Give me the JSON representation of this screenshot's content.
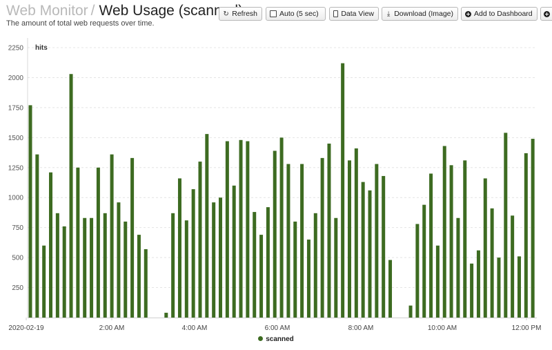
{
  "header": {
    "breadcrumb_parent": "Web Monitor",
    "separator": "/",
    "title": "Web Usage (scanned)",
    "subtitle": "The amount of total web requests over time."
  },
  "toolbar": {
    "refresh_label": "Refresh",
    "auto_label": "Auto (5 sec)",
    "data_view_label": "Data View",
    "download_label": "Download (Image)",
    "dashboard_label": "Add to Dashboard",
    "refresh_icon": "refresh-icon",
    "download_icon": "download-icon",
    "dashboard_icon": "plus-circle-icon"
  },
  "chart_data": {
    "type": "bar",
    "ylabel": "hits",
    "ylim": [
      0,
      2250
    ],
    "yticks": [
      250,
      500,
      750,
      1000,
      1250,
      1500,
      1750,
      2000,
      2250
    ],
    "grid": true,
    "legend_position": "bottom-center",
    "bar_color": "#3d6b21",
    "xtick_labels": [
      "2020-02-19",
      "2:00 AM",
      "4:00 AM",
      "6:00 AM",
      "8:00 AM",
      "10:00 AM",
      "12:00 PM"
    ],
    "series": [
      {
        "name": "scanned",
        "values": [
          1770,
          1360,
          600,
          1210,
          870,
          760,
          2030,
          1250,
          830,
          830,
          1250,
          870,
          1360,
          960,
          800,
          1330,
          690,
          570,
          0,
          0,
          40,
          870,
          1160,
          810,
          1070,
          1300,
          1530,
          960,
          1000,
          1470,
          1100,
          1480,
          1470,
          880,
          690,
          920,
          1390,
          1500,
          1280,
          800,
          1280,
          650,
          870,
          1330,
          1450,
          830,
          2120,
          1310,
          1410,
          1130,
          1060,
          1280,
          1180,
          480,
          0,
          0,
          100,
          780,
          940,
          1200,
          600,
          1430,
          1270,
          830,
          1310,
          450,
          560,
          1160,
          910,
          500,
          1540,
          850,
          510,
          1370,
          1490
        ]
      }
    ]
  }
}
